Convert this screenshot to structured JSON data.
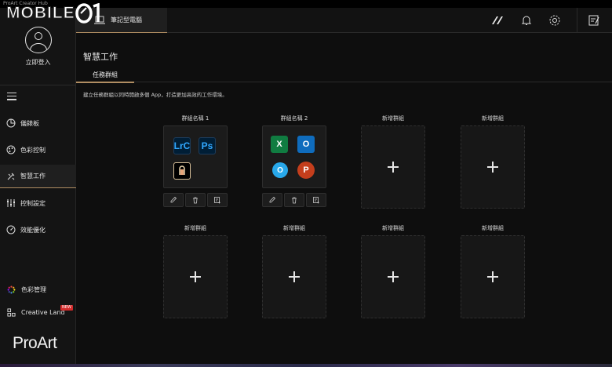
{
  "window": {
    "title": "ProArt Creator Hub"
  },
  "watermark": {
    "text": "MOBILE"
  },
  "sidebar": {
    "login_label": "立即登入",
    "items": [
      {
        "label": "儀錶板",
        "icon": "dashboard-icon"
      },
      {
        "label": "色彩控制",
        "icon": "color-control-icon"
      },
      {
        "label": "智慧工作",
        "icon": "smart-work-icon",
        "active": true
      },
      {
        "label": "控制設定",
        "icon": "sliders-icon"
      },
      {
        "label": "效能優化",
        "icon": "gauge-icon"
      }
    ],
    "bottom": [
      {
        "label": "色彩管理",
        "icon": "color-wheel-icon"
      },
      {
        "label": "Creative Land",
        "icon": "creative-land-icon",
        "badge": "NEW"
      }
    ],
    "brand": "ProArt"
  },
  "topbar": {
    "device_tab": "筆記型電腦"
  },
  "main": {
    "title": "智慧工作",
    "subtab": "任務群組",
    "description": "建立任務群組以同時開啟多個 App，打造更加高效的工作環境。",
    "groups_row1": [
      {
        "name": "群組名稱 1",
        "apps": [
          "Lightroom Classic",
          "Photoshop",
          "ProArt app"
        ]
      },
      {
        "name": "群組名稱 2",
        "apps": [
          "Excel",
          "Outlook",
          "Outlook (new)",
          "PowerPoint"
        ]
      },
      {
        "name": "新增群組"
      },
      {
        "name": "新增群組"
      }
    ],
    "groups_row2": [
      {
        "name": "新增群組"
      },
      {
        "name": "新增群組"
      },
      {
        "name": "新增群組"
      },
      {
        "name": "新增群組"
      }
    ],
    "app_labels": {
      "lrc": "LrC",
      "ps": "Ps",
      "excel": "X",
      "outlook": "O",
      "outlook_new": "O",
      "powerpoint": "P"
    }
  },
  "colors": {
    "accent": "#b08d62",
    "background": "#0e0e0e",
    "sidebar": "#141414",
    "badge": "#d32b2b"
  }
}
